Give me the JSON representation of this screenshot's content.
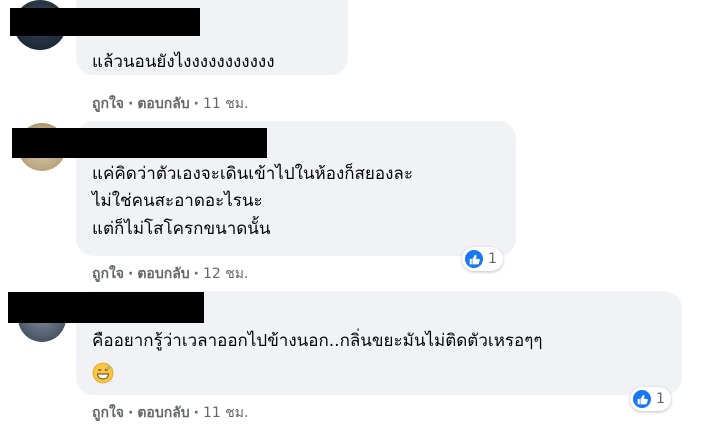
{
  "comments": [
    {
      "text_lines": [
        "แล้วนอนยังไงงงงงงงงงงง"
      ],
      "actions": {
        "like": "ถูกใจ",
        "reply": "ตอบกลับ",
        "time": "11 ชม.",
        "separator": "·"
      }
    },
    {
      "text_lines": [
        "แค่คิดว่าตัวเองจะเดินเข้าไปในห้องก็สยองละ",
        "ไม่ใช่คนสะอาดอะไรนะ",
        "แต่ก็ไม่โสโครกขนาดนั้น"
      ],
      "actions": {
        "like": "ถูกใจ",
        "reply": "ตอบกลับ",
        "time": "12 ชม.",
        "separator": "·"
      },
      "reaction_count": "1"
    },
    {
      "text_lines": [
        "คืออยากรู้ว่าเวลาออกไปข้างนอก..กลิ่นขยะมันไม่ติดตัวเหรอๆๆ"
      ],
      "emoji": "grinning-sweat-emoji",
      "actions": {
        "like": "ถูกใจ",
        "reply": "ตอบกลับ",
        "time": "11 ชม.",
        "separator": "·"
      },
      "reaction_count": "1"
    }
  ],
  "colors": {
    "bubble": "#f0f2f5",
    "action_text": "#65676b",
    "like_blue": "#1877f2",
    "redaction": "#000000"
  }
}
